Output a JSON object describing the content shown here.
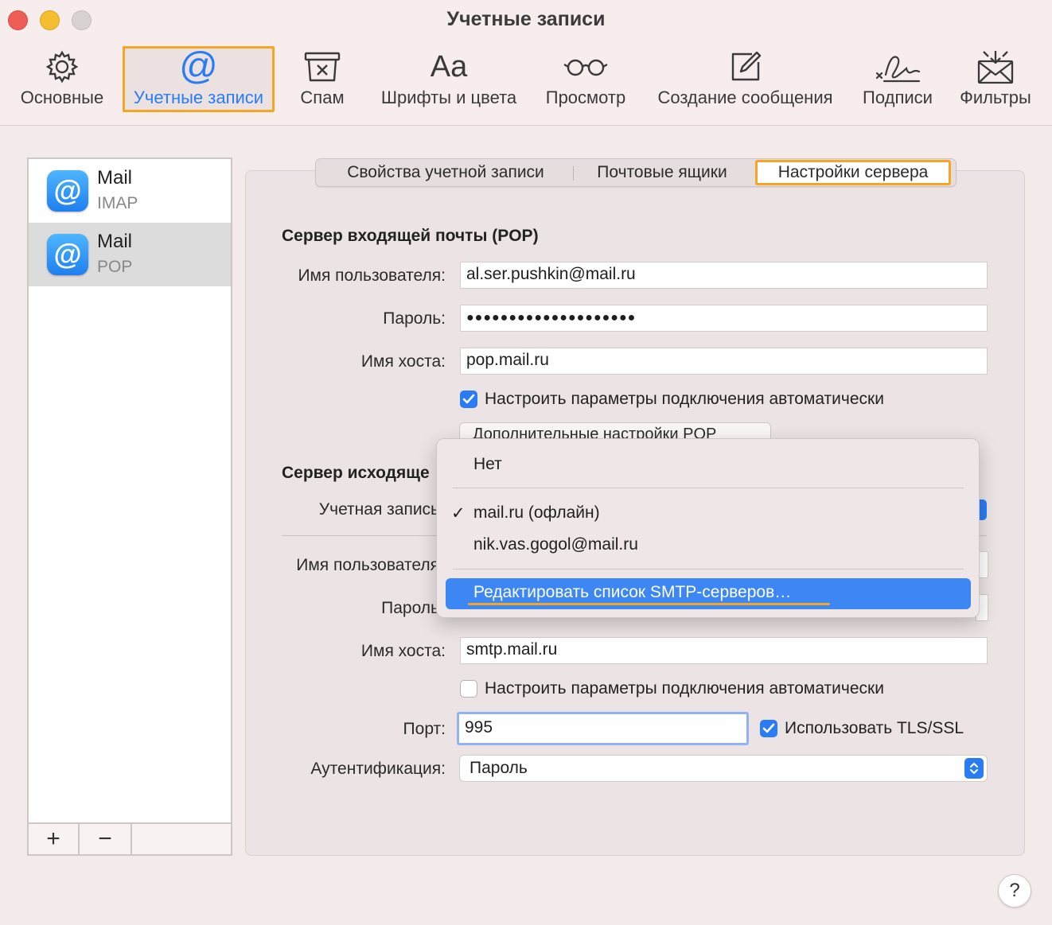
{
  "window": {
    "title": "Учетные записи"
  },
  "toolbar": {
    "items": [
      {
        "label": "Основные",
        "icon": "gear-icon"
      },
      {
        "label": "Учетные записи",
        "icon": "at-icon"
      },
      {
        "label": "Спам",
        "icon": "junk-bin-icon"
      },
      {
        "label": "Шрифты и цвета",
        "icon": "fonts-icon",
        "glyph": "Aa"
      },
      {
        "label": "Просмотр",
        "icon": "glasses-icon"
      },
      {
        "label": "Создание сообщения",
        "icon": "compose-icon"
      },
      {
        "label": "Подписи",
        "icon": "signature-icon"
      },
      {
        "label": "Фильтры",
        "icon": "filter-envelope-icon"
      }
    ],
    "active_index": 1,
    "accent_color": "#2a7cf6",
    "highlight_color": "#f5a623"
  },
  "accounts": [
    {
      "name": "Mail",
      "type": "IMAP",
      "selected": false
    },
    {
      "name": "Mail",
      "type": "POP",
      "selected": true
    }
  ],
  "account_list_footer": {
    "add": "+",
    "remove": "−"
  },
  "tabs": [
    {
      "label": "Свойства учетной записи"
    },
    {
      "label": "Почтовые ящики"
    },
    {
      "label": "Настройки сервера",
      "active": true
    }
  ],
  "incoming": {
    "title": "Сервер входящей почты (POP)",
    "username_label": "Имя пользователя:",
    "username": "al.ser.pushkin@mail.ru",
    "password_label": "Пароль:",
    "password_mask": "●●●●●●●●●●●●●●●●●●●●",
    "host_label": "Имя хоста:",
    "host": "pop.mail.ru",
    "auto_label": "Настроить параметры подключения автоматически",
    "auto_checked": true,
    "advanced_button": "Дополнительные настройки POP"
  },
  "outgoing": {
    "title": "Сервер исходяще",
    "account_label": "Учетная запись",
    "username_label": "Имя пользователя",
    "password_label": "Пароль",
    "host_label": "Имя хоста:",
    "host": "smtp.mail.ru",
    "auto_label": "Настроить параметры подключения автоматически",
    "auto_checked": false,
    "port_label": "Порт:",
    "port": "995",
    "tls_label": "Использовать TLS/SSL",
    "tls_checked": true,
    "auth_label": "Аутентификация:",
    "auth_value": "Пароль"
  },
  "smtp_menu": {
    "items": [
      "Нет",
      "mail.ru (офлайн)",
      "nik.vas.gogol@mail.ru"
    ],
    "checked_index": 1,
    "check_mark": "✓",
    "highlighted": "Редактировать список SMTP-серверов…"
  },
  "help": "?"
}
